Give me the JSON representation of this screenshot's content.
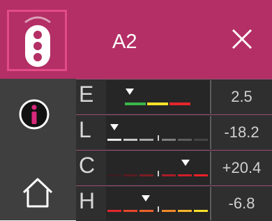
{
  "header": {
    "title": "A2"
  },
  "colors": {
    "accent": "#b32f65",
    "sidebar": "#3f3f3f",
    "row_bg": "#2f2f2f"
  },
  "sidebar": {
    "items": [
      {
        "icon": "traffic-light-icon",
        "selected": true
      },
      {
        "icon": "info-icon"
      },
      {
        "icon": "home-icon"
      }
    ]
  },
  "rows": [
    {
      "label": "E",
      "value": "2.5"
    },
    {
      "label": "L",
      "value": "-18.2"
    },
    {
      "label": "C",
      "value": "+20.4"
    },
    {
      "label": "H",
      "value": "-6.8"
    }
  ]
}
